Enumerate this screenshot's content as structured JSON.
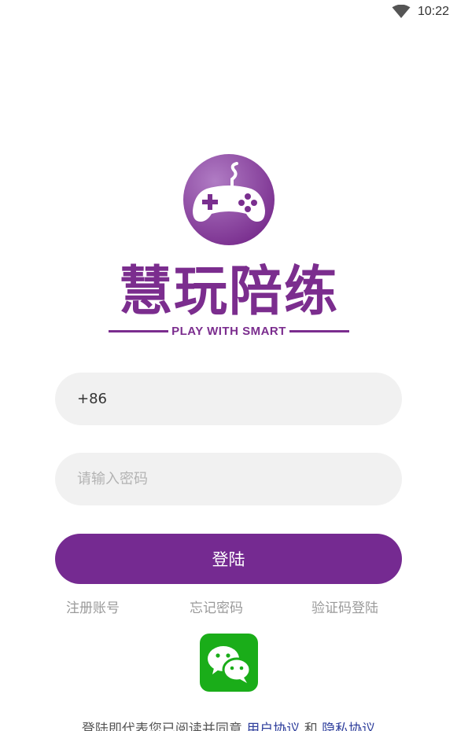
{
  "status_bar": {
    "time": "10:22"
  },
  "brand": {
    "name": "慧玩陪练",
    "tagline": "PLAY WITH SMART",
    "color": "#7b2d8e"
  },
  "login_form": {
    "phone_value": "+86",
    "password_placeholder": "请输入密码",
    "login_label": "登陆",
    "button_color": "#752a91"
  },
  "links": {
    "register": "注册账号",
    "forgot_password": "忘记密码",
    "sms_login": "验证码登陆"
  },
  "wechat": {
    "icon": "wechat-icon",
    "color": "#1aad19"
  },
  "agreement": {
    "prefix": "登陆即代表您已阅读并同意",
    "user_agreement": "用户协议",
    "and": "和",
    "privacy_policy": "隐私协议"
  }
}
